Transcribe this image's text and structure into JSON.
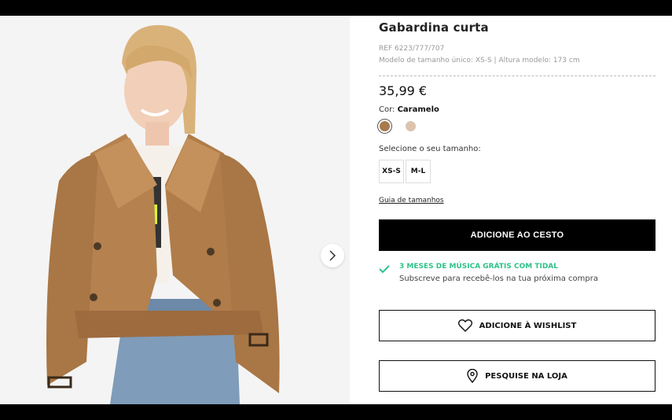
{
  "product": {
    "title": "Gabardina curta",
    "ref": "REF 6223/777/707",
    "model_info": "Modelo de tamanho único: XS-S | Altura modelo: 173 cm",
    "price": "35,99 €",
    "color_label": "Cor:",
    "color_value": "Caramelo",
    "colors": [
      "#a77a4d",
      "#dcc3ae"
    ],
    "size_label": "Selecione o seu tamanho:",
    "sizes": [
      "XS-S",
      "M-L"
    ],
    "size_guide": "Guia de tamanhos"
  },
  "actions": {
    "add_to_cart": "ADICIONE AO CESTO",
    "wishlist": "ADICIONE À WISHLIST",
    "find_store": "PESQUISE NA LOJA"
  },
  "promo": {
    "title": "3 MESES DE MÚSICA GRÁTIS COM TIDAL",
    "subtitle": "Subscreve para recebê-los na tua próxima compra",
    "accent": "#2ec28a"
  },
  "icons": {
    "next": "chevron-right-icon",
    "promo": "check-icon",
    "wishlist": "heart-icon",
    "store": "location-pin-icon"
  }
}
